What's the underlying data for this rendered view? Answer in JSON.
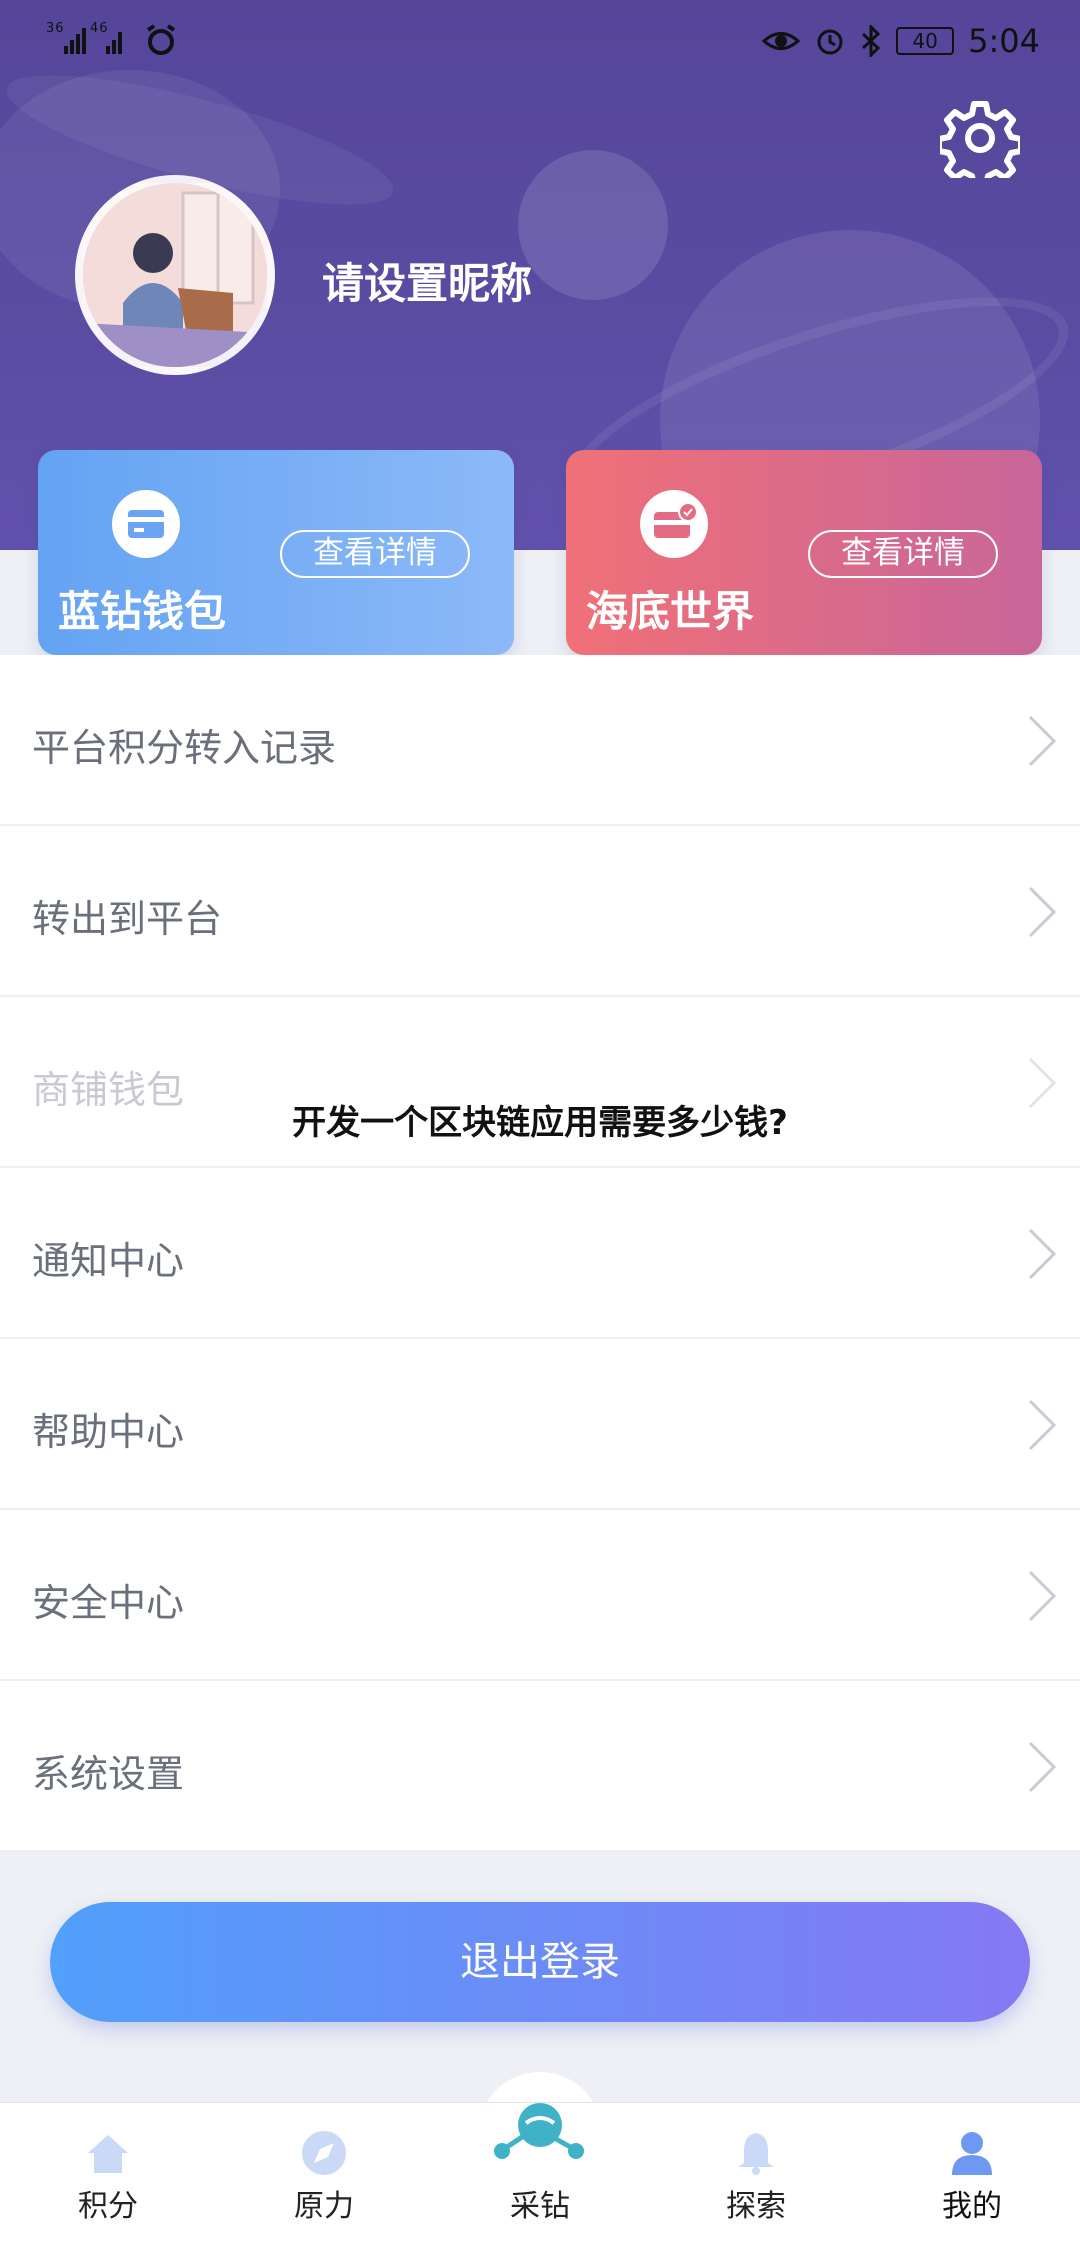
{
  "status_bar": {
    "network_left": "36 46",
    "time": "5:04",
    "battery": "40"
  },
  "profile": {
    "nickname": "请设置昵称"
  },
  "cards": [
    {
      "title": "蓝钻钱包",
      "detail_label": "查看详情",
      "icon": "card-icon",
      "color": "#6fa8f5"
    },
    {
      "title": "海底世界",
      "detail_label": "查看详情",
      "icon": "ticket-icon",
      "color": "#e86b82"
    }
  ],
  "menu": {
    "items": [
      {
        "label": "平台积分转入记录"
      },
      {
        "label": "转出到平台"
      },
      {
        "label": "商铺钱包"
      },
      {
        "label": "通知中心"
      },
      {
        "label": "帮助中心"
      },
      {
        "label": "安全中心"
      },
      {
        "label": "系统设置"
      }
    ]
  },
  "overlay_caption": "开发一个区块链应用需要多少钱?",
  "logout_label": "退出登录",
  "tabbar": {
    "items": [
      {
        "label": "积分",
        "icon": "home-icon"
      },
      {
        "label": "原力",
        "icon": "compass-icon"
      },
      {
        "label": "采钻",
        "icon": "mining-icon"
      },
      {
        "label": "探索",
        "icon": "bell-icon"
      },
      {
        "label": "我的",
        "icon": "user-icon"
      }
    ]
  },
  "colors": {
    "header_bg": "#55469a",
    "accent_blue": "#51a0fb",
    "accent_purple": "#8579f3"
  }
}
